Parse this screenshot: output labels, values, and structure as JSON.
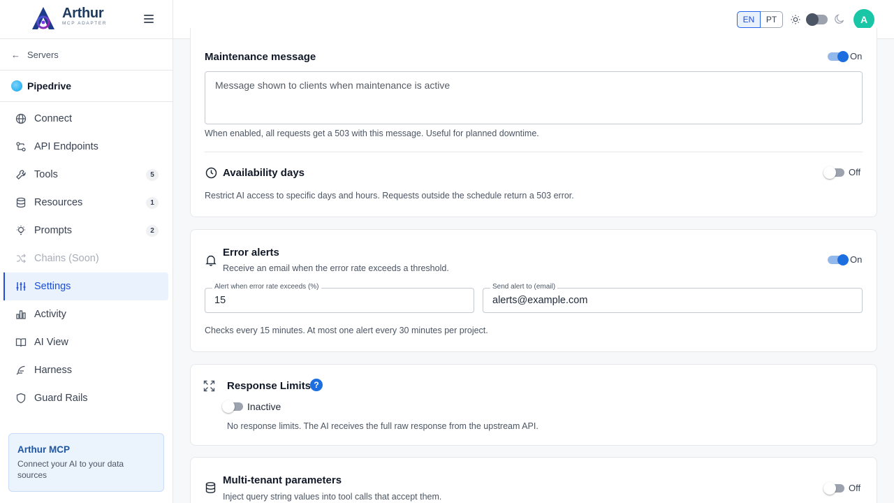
{
  "brand": {
    "name": "Arthur",
    "subtitle": "MCP ADAPTER"
  },
  "sidebar": {
    "back_label": "Servers",
    "server_name": "Pipedrive",
    "items": [
      {
        "label": "Connect"
      },
      {
        "label": "API Endpoints"
      },
      {
        "label": "Tools",
        "badge": "5"
      },
      {
        "label": "Resources",
        "badge": "1"
      },
      {
        "label": "Prompts",
        "badge": "2"
      },
      {
        "label": "Chains (Soon)"
      },
      {
        "label": "Settings"
      },
      {
        "label": "Activity"
      },
      {
        "label": "AI View"
      },
      {
        "label": "Harness"
      },
      {
        "label": "Guard Rails"
      }
    ],
    "promo": {
      "title": "Arthur MCP",
      "text": "Connect your AI to your data sources"
    }
  },
  "topbar": {
    "lang_en": "EN",
    "lang_pt": "PT",
    "avatar_initial": "A"
  },
  "maintenance": {
    "title": "Maintenance message",
    "toggle_label": "On",
    "placeholder": "Message shown to clients when maintenance is active",
    "help": "When enabled, all requests get a 503 with this message. Useful for planned downtime."
  },
  "availability": {
    "title": "Availability days",
    "toggle_label": "Off",
    "description": "Restrict AI access to specific days and hours. Requests outside the schedule return a 503 error."
  },
  "error_alerts": {
    "title": "Error alerts",
    "subtitle": "Receive an email when the error rate exceeds a threshold.",
    "toggle_label": "On",
    "threshold_label": "Alert when error rate exceeds (%)",
    "threshold_value": "15",
    "email_label": "Send alert to (email)",
    "email_value": "alerts@example.com",
    "note": "Checks every 15 minutes. At most one alert every 30 minutes per project."
  },
  "response_limits": {
    "title": "Response Limits",
    "help": "?",
    "toggle_label": "Inactive",
    "description": "No response limits. The AI receives the full raw response from the upstream API."
  },
  "multi_tenant": {
    "title": "Multi-tenant parameters",
    "subtitle": "Inject query string values into tool calls that accept them.",
    "toggle_label": "Off"
  },
  "colors": {
    "accent": "#1d6fe0",
    "active_bg": "#eaf2fd",
    "avatar": "#19c7a6"
  }
}
